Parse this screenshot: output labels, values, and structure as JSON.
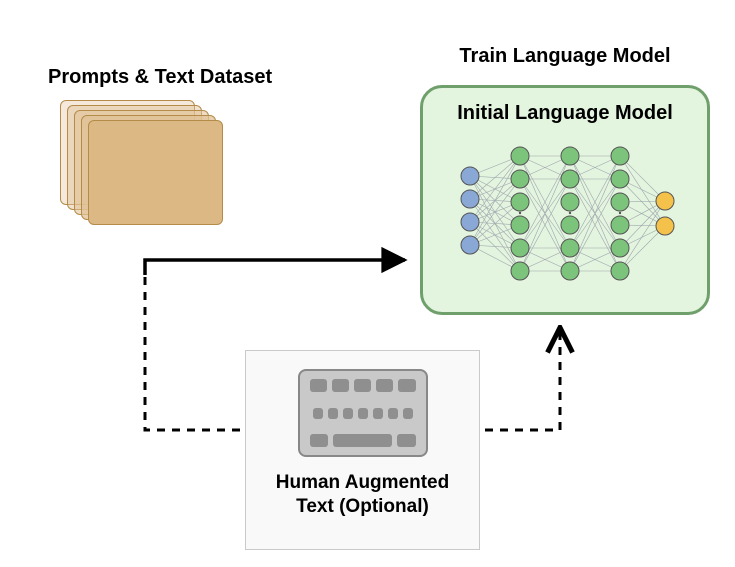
{
  "labels": {
    "dataset": "Prompts & Text Dataset",
    "train": "Train Language Model",
    "model": "Initial Language Model",
    "augment_line1": "Human Augmented",
    "augment_line2": "Text (Optional)"
  },
  "icons": {
    "dataset": "card-stack",
    "keyboard": "keyboard",
    "network": "neural-network"
  },
  "arrows": {
    "main_solid": {
      "from": "dataset",
      "to": "model",
      "style": "solid"
    },
    "aug_in": {
      "from": "dataset",
      "to": "augment",
      "style": "dashed"
    },
    "aug_out": {
      "from": "augment",
      "to": "model",
      "style": "dashed"
    }
  },
  "colors": {
    "card": "#dcb884",
    "model_border": "#6fa06b",
    "model_bg": "#e3f4df",
    "nn_input": "#8aa8d6",
    "nn_hidden": "#7cc47c",
    "nn_output": "#f4c24a"
  }
}
